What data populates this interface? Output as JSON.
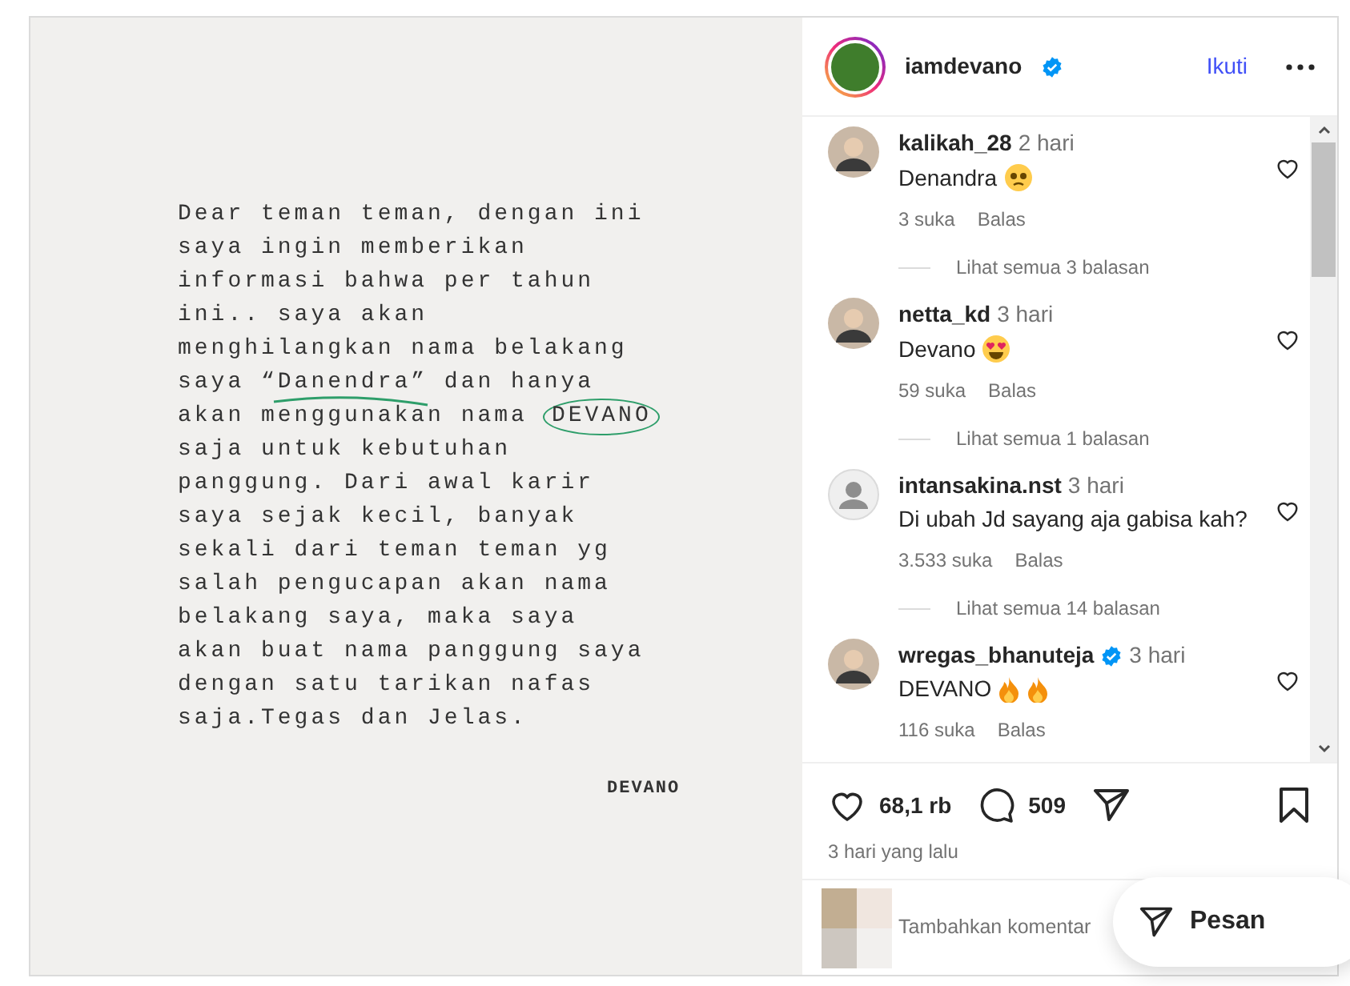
{
  "post": {
    "letter_lines": [
      "Dear teman teman, dengan ini",
      "saya ingin memberikan",
      "informasi bahwa per tahun",
      "ini.. saya akan",
      "menghilangkan nama belakang",
      "saya “Danendra” dan hanya",
      {
        "text": "akan menggunakan nama",
        "circled": "DEVANO"
      },
      "saja untuk kebutuhan",
      "panggung. Dari awal karir",
      "saya sejak kecil, banyak",
      "sekali dari teman teman yg",
      "salah pengucapan akan nama",
      "belakang saya, maka saya",
      "akan buat nama panggung saya",
      "dengan satu tarikan nafas",
      "saja.Tegas dan Jelas."
    ],
    "signature": "DEVANO"
  },
  "header": {
    "username": "iamdevano",
    "verified": true,
    "follow": "Ikuti"
  },
  "comments": [
    {
      "username": "kalikah_28",
      "verified": false,
      "time": "2 hari",
      "text": "Denandra",
      "emojis": [
        {
          "kind": "pleading"
        }
      ],
      "likes": "3 suka",
      "reply": "Balas",
      "view_replies": "Lihat semua 3 balasan",
      "avatar": {
        "kind": "photo"
      }
    },
    {
      "username": "netta_kd",
      "verified": false,
      "time": "3 hari",
      "text": "Devano",
      "emojis": [
        {
          "kind": "heart-eyes"
        }
      ],
      "likes": "59 suka",
      "reply": "Balas",
      "view_replies": "Lihat semua 1 balasan",
      "avatar": {
        "kind": "photo"
      }
    },
    {
      "username": "intansakina.nst",
      "verified": false,
      "time": "3 hari",
      "text": "Di ubah Jd sayang aja gabisa kah?",
      "likes": "3.533 suka",
      "reply": "Balas",
      "view_replies": "Lihat semua 14 balasan",
      "avatar": {
        "kind": "default"
      }
    },
    {
      "username": "wregas_bhanuteja",
      "verified": true,
      "time": "3 hari",
      "text": "DEVANO",
      "emojis": [
        {
          "kind": "fire"
        },
        {
          "kind": "fire"
        }
      ],
      "likes": "116 suka",
      "reply": "Balas",
      "avatar": {
        "kind": "photo"
      }
    }
  ],
  "actions": {
    "likes": "68,1 rb",
    "comments": "509",
    "posted": "3 hari yang lalu"
  },
  "composer": {
    "placeholder": "Tambahkan komentar"
  },
  "message_popup": {
    "label": "Pesan"
  }
}
